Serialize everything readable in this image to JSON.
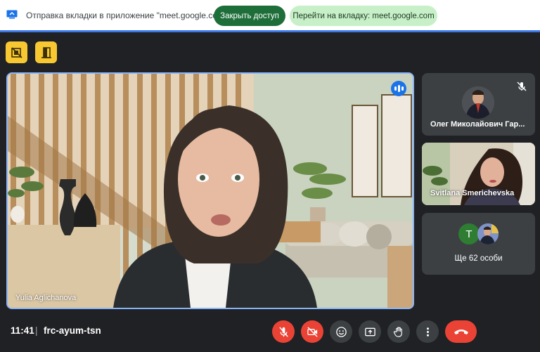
{
  "share_bar": {
    "text": "Отправка вкладки в приложение \"meet.google.com\"...",
    "stop_label": "Закрыть доступ",
    "goto_label": "Перейти на вкладку: meet.google.com",
    "icon": "screen-share-icon"
  },
  "top_tools": {
    "icons": [
      "video-off-overlay-icon",
      "exit-door-icon"
    ]
  },
  "main_tile": {
    "participant_name": "Yulia Aglichanova",
    "speaking": true
  },
  "side_tiles": [
    {
      "name": "Олег Миколайович Гар...",
      "muted": true
    },
    {
      "name": "Svitlana Smerichevska"
    },
    {
      "avatar_letter": "T",
      "more_label": "Ще 62 особи"
    }
  ],
  "bottom_bar": {
    "time": "11:41",
    "separator": "|",
    "meeting_code": "frc-ayum-tsn"
  },
  "colors": {
    "accent_blue": "#8ab4f8",
    "danger_red": "#ea4335",
    "warning_yellow": "#f7c832",
    "share_green": "#1e6e3a",
    "background": "#202124"
  }
}
